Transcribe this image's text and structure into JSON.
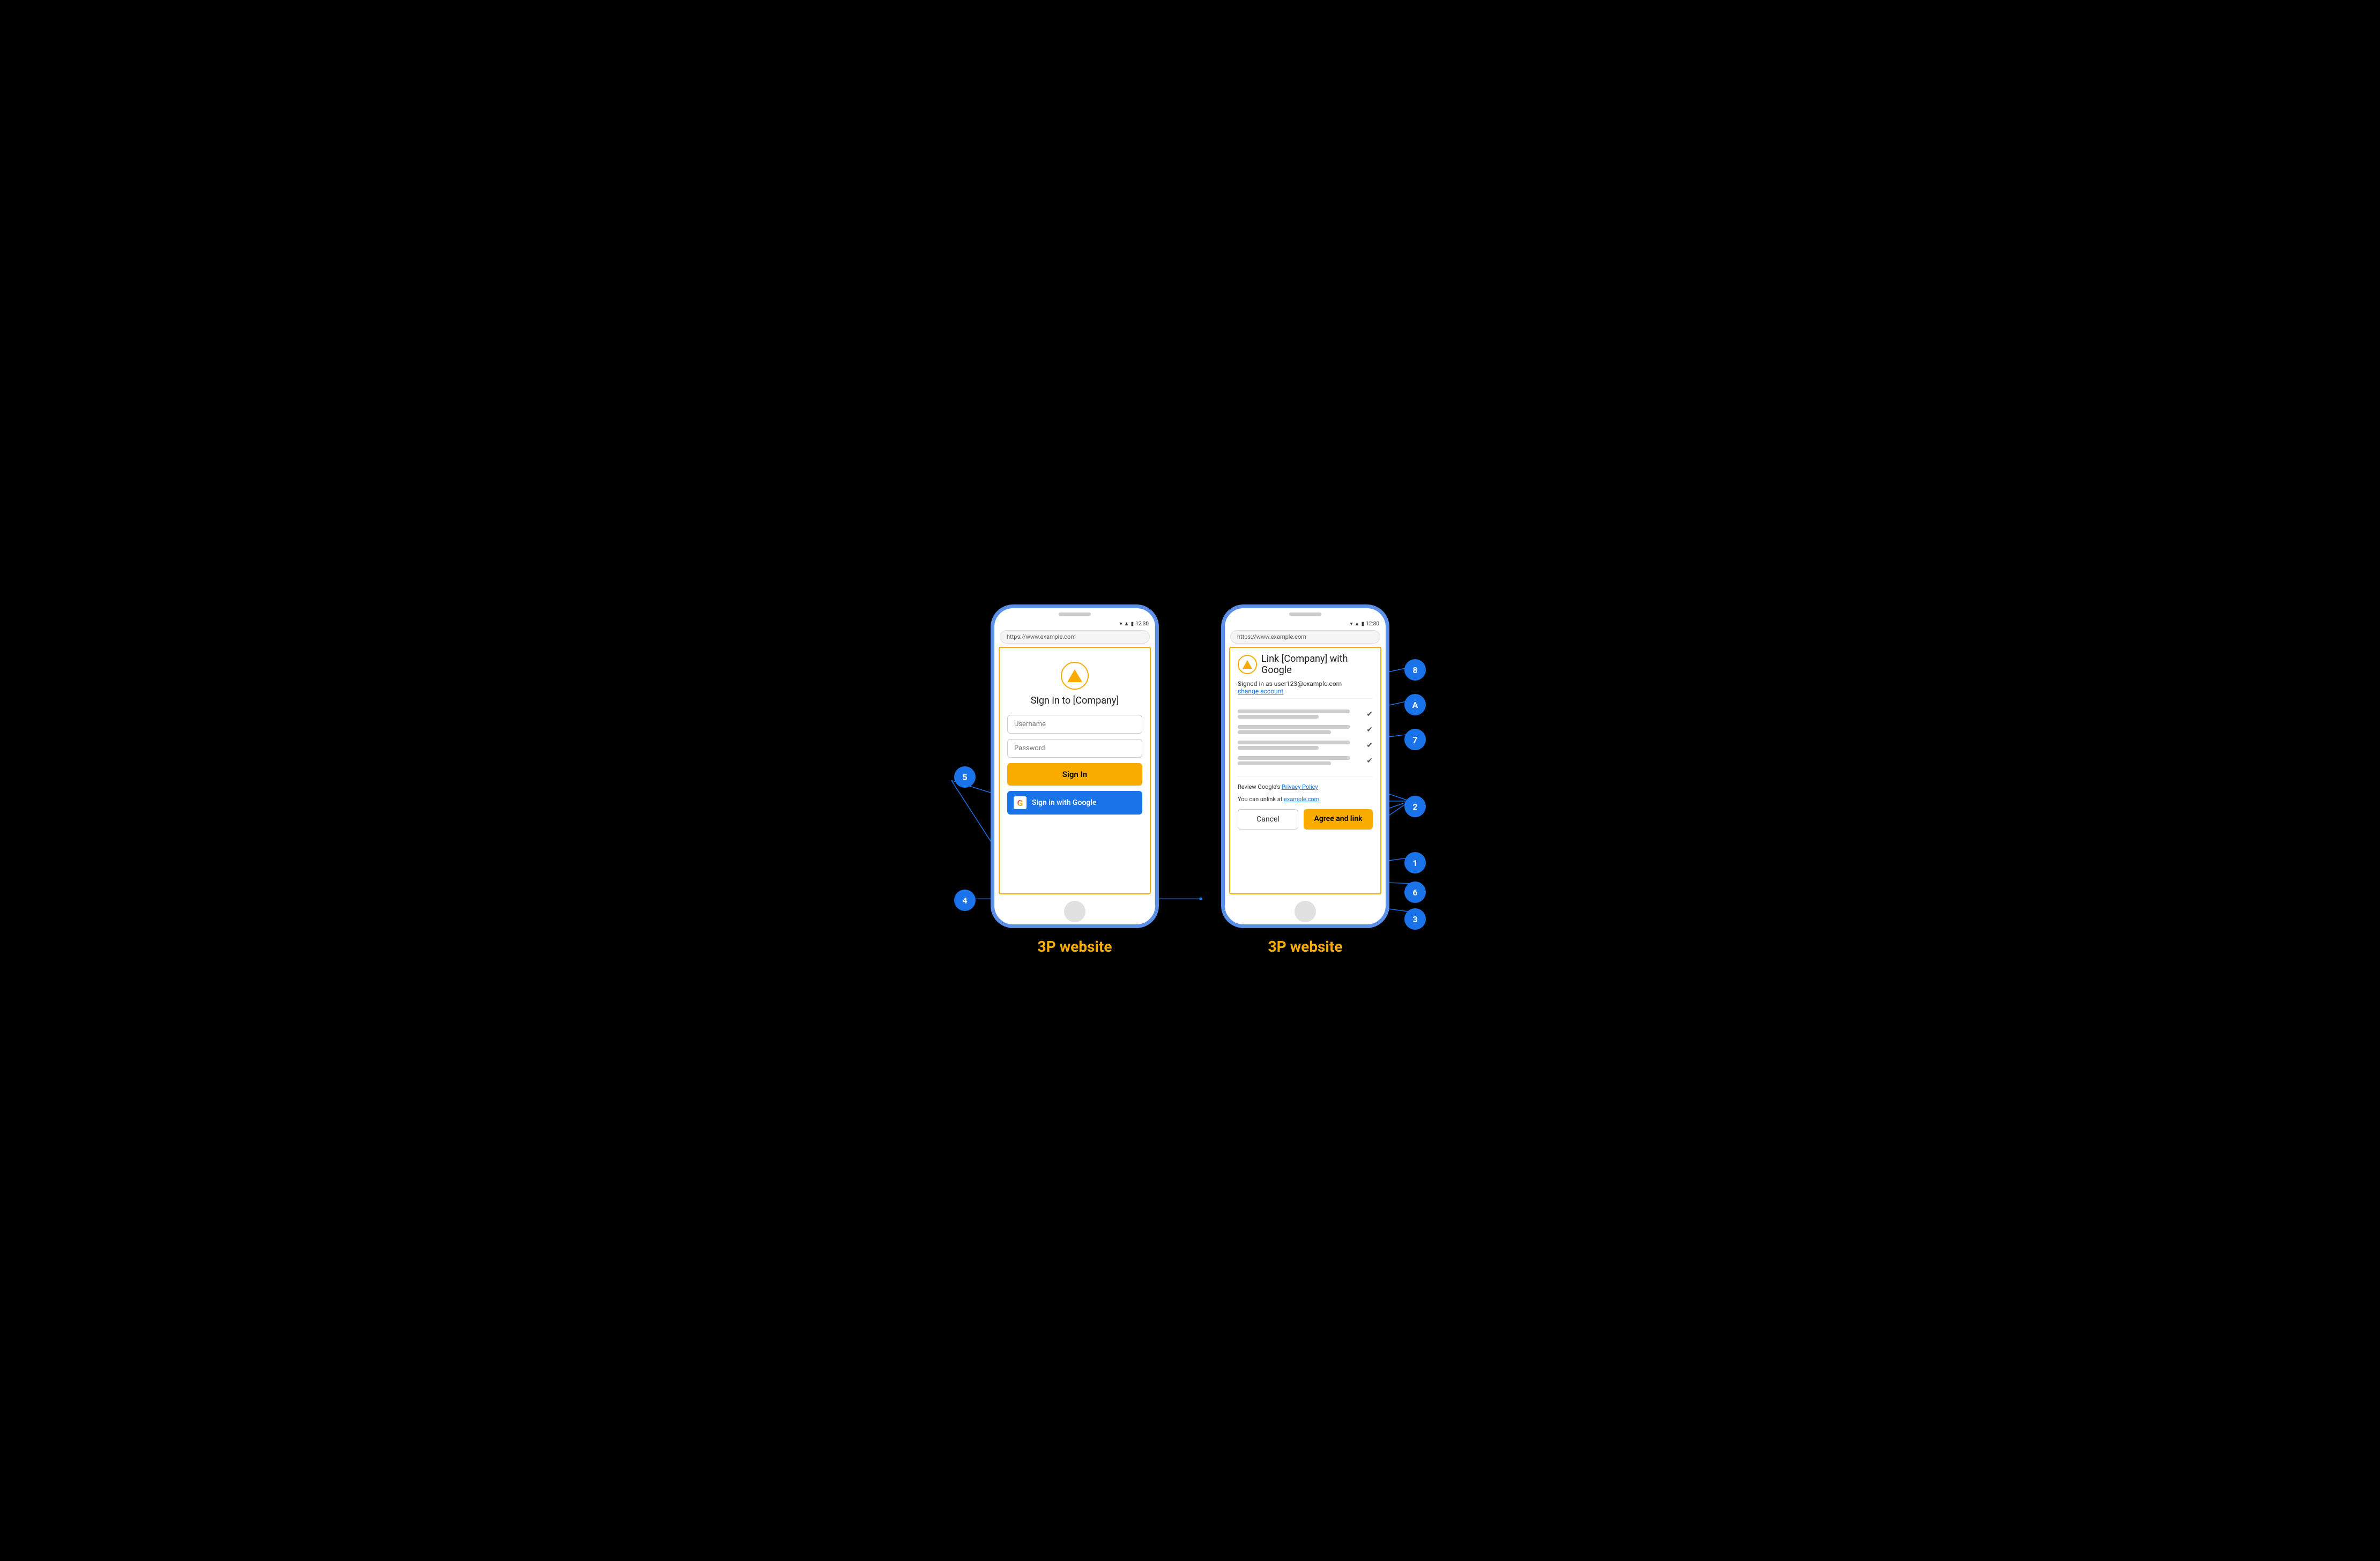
{
  "phones": [
    {
      "id": "phone1",
      "label": "3P website",
      "url": "https://www.example.com",
      "time": "12:30",
      "screen": {
        "type": "signin",
        "title": "Sign in to [Company]",
        "username_placeholder": "Username",
        "password_placeholder": "Password",
        "sign_in_button": "Sign In",
        "google_button": "Sign in with Google"
      }
    },
    {
      "id": "phone2",
      "label": "3P website",
      "url": "https://www.example.com",
      "time": "12:30",
      "screen": {
        "type": "link",
        "title": "Link [Company] with Google",
        "signed_in_text": "Signed in as user123@example.com",
        "change_account": "change account",
        "permissions": [
          {
            "lines": [
              "long",
              "medium"
            ]
          },
          {
            "lines": [
              "long",
              "short"
            ]
          },
          {
            "lines": [
              "long",
              "medium"
            ]
          },
          {
            "lines": [
              "long",
              "short"
            ]
          }
        ],
        "policy_text": "Review Google's ",
        "policy_link": "Privacy Policy",
        "unlink_text": "You can unlink at ",
        "unlink_link": "example.com",
        "cancel_button": "Cancel",
        "agree_button": "Agree and link"
      }
    }
  ],
  "badges": [
    {
      "id": "badge-5",
      "label": "5"
    },
    {
      "id": "badge-4",
      "label": "4"
    },
    {
      "id": "badge-8",
      "label": "8"
    },
    {
      "id": "badge-A",
      "label": "A"
    },
    {
      "id": "badge-7",
      "label": "7"
    },
    {
      "id": "badge-2",
      "label": "2"
    },
    {
      "id": "badge-1",
      "label": "1"
    },
    {
      "id": "badge-6",
      "label": "6"
    },
    {
      "id": "badge-3",
      "label": "3"
    }
  ],
  "colors": {
    "badge_bg": "#1a73e8",
    "badge_text": "#ffffff",
    "label_color": "#F9AB00",
    "google_blue": "#1a73e8",
    "sign_in_yellow": "#F9AB00",
    "phone_border": "#5B8FE8"
  }
}
